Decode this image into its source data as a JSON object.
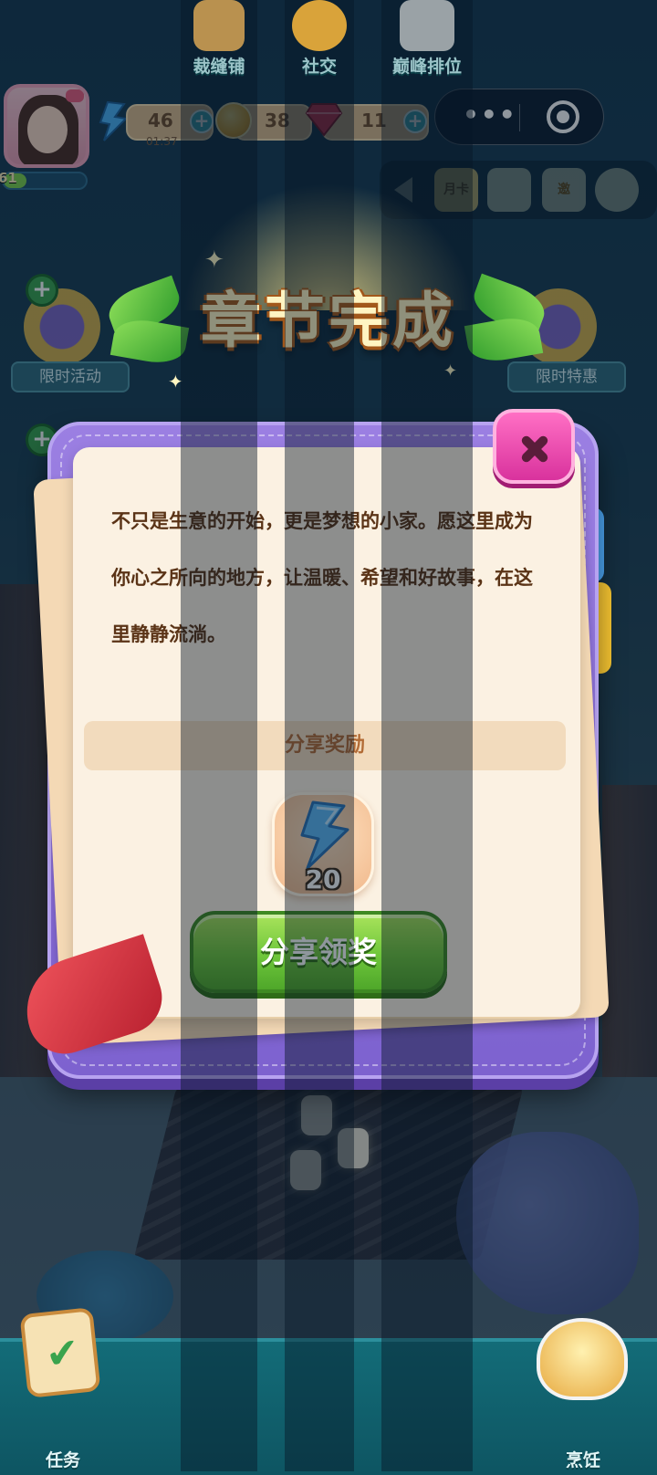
{
  "hud": {
    "level": "61",
    "energy": "46",
    "energy_timer": "01:37",
    "coins": "38",
    "gems": "11",
    "plus": "+"
  },
  "capsule": {
    "more_label": "•••"
  },
  "toolbar": {
    "monthly_card": "月卡",
    "invite": "邀"
  },
  "side_left": {
    "label": "限时活动"
  },
  "side_right": {
    "label": "限时特惠"
  },
  "banner": {
    "title": "章节完成"
  },
  "dialog": {
    "story": "不只是生意的开始，更是梦想的小家。愿这里成为你心之所向的地方，让温暖、希望和好故事，在这里静静流淌。",
    "reward_header": "分享奖励",
    "reward_amount": "20",
    "share_button": "分享领奖",
    "reward_icon": "lightning-energy-icon"
  },
  "nav": {
    "items": [
      {
        "label": "任务",
        "icon": "task-checklist-icon"
      },
      {
        "label": "裁缝铺",
        "icon": "sewing-machine-icon"
      },
      {
        "label": "社交",
        "icon": "social-chat-icon"
      },
      {
        "label": "巅峰排位",
        "icon": "trophy-locked-icon"
      },
      {
        "label": "烹饪",
        "icon": "soup-bowl-icon"
      }
    ]
  },
  "colors": {
    "dialog_purple": "#8b6fdc",
    "paper": "#fbf1e2",
    "share_green": "#6ec63b",
    "close_pink": "#e84bb0",
    "nav_teal": "#136c78"
  }
}
